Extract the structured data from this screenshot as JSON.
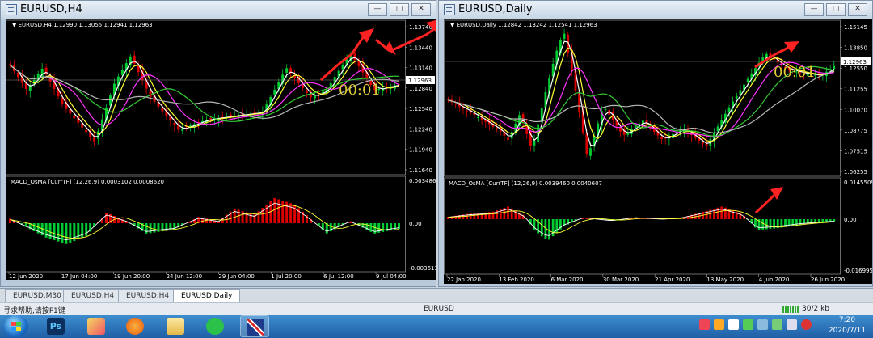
{
  "colors": {
    "bull": "#dd0000",
    "bear": "#00cc33",
    "ma_fast": "#ffffff",
    "ma_mid": "#ffff33",
    "ma_slow": "#ff33ff",
    "ma_green": "#33cc33",
    "ma_gray": "#b8b8b8",
    "timer": "#ddcc33",
    "arrow": "#ff2222"
  },
  "window_left": {
    "title": "EURUSD,H4",
    "header": "EURUSD,H4  1.12990 1.13055 1.12941 1.12963",
    "price_ticks": [
      "1.13740",
      "1.13440",
      "1.13140",
      "1.12840",
      "1.12540",
      "1.12240",
      "1.11940",
      "1.11640"
    ],
    "current_price": "1.12963",
    "timer": "00:01",
    "macd_title": "MACD_OsMA [CurrTF] (12,26,9) 0.0003102 0.0008620",
    "macd_ticks": [
      "0.0034865",
      "0.00",
      "-0.003613"
    ],
    "date_labels": [
      "12 Jun 2020",
      "17 Jun 04:00",
      "19 Jun 20:00",
      "24 Jun 12:00",
      "29 Jun 04:00",
      "1 Jul 20:00",
      "6 Jul 12:00",
      "9 Jul 04:00"
    ]
  },
  "window_right": {
    "title": "EURUSD,Daily",
    "header": "EURUSD,Daily  1.12842 1.13242 1.12541 1.12963",
    "price_ticks": [
      "1.15145",
      "1.13850",
      "1.12550",
      "1.11255",
      "1.10070",
      "1.08775",
      "1.07515",
      "1.06255"
    ],
    "current_price": "1.12963",
    "timer": "00:01",
    "macd_title": "MACD_OsMA [CurrTF] (12,26,9) 0.0039460 0.0040607",
    "macd_ticks": [
      "0.0145509",
      "0.00",
      "-0.016995"
    ],
    "date_labels": [
      "22 Jan 2020",
      "13 Feb 2020",
      "6 Mar 2020",
      "30 Mar 2020",
      "21 Apr 2020",
      "13 May 2020",
      "4 Jun 2020",
      "26 Jun 2020"
    ]
  },
  "tabs": [
    "EURUSD,M30",
    "EURUSD,H4",
    "EURUSD,H4",
    "EURUSD,Daily"
  ],
  "status": {
    "help": "寻求帮助,请按F1键",
    "symbol": "EURUSD",
    "bytes": "30/2 kb"
  },
  "taskbar": {
    "apps": [
      {
        "name": "photoshop",
        "label": "Ps"
      },
      {
        "name": "chart-app",
        "label": ""
      },
      {
        "name": "browser",
        "label": ""
      },
      {
        "name": "file-explorer",
        "label": ""
      },
      {
        "name": "wechat",
        "label": ""
      },
      {
        "name": "flag-app",
        "label": ""
      }
    ],
    "time": "7:20",
    "date": "2020/7/11"
  }
}
